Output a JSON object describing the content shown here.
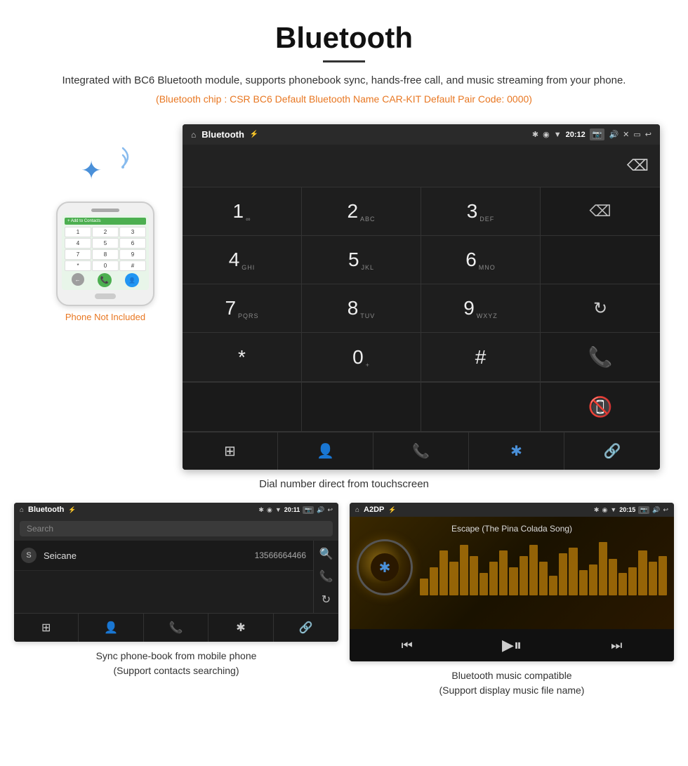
{
  "page": {
    "title": "Bluetooth",
    "divider": true,
    "description": "Integrated with BC6 Bluetooth module, supports phonebook sync, hands-free call, and music streaming from your phone.",
    "specs": "(Bluetooth chip : CSR BC6    Default Bluetooth Name CAR-KIT    Default Pair Code: 0000)",
    "caption_dial": "Dial number direct from touchscreen",
    "caption_phonebook": "Sync phone-book from mobile phone\n(Support contacts searching)",
    "caption_music": "Bluetooth music compatible\n(Support display music file name)"
  },
  "phone_label": "Phone Not Included",
  "dialpad": {
    "status_bar": {
      "home_icon": "⌂",
      "title": "Bluetooth",
      "usb_icon": "⚡",
      "bt_icon": "✱",
      "location_icon": "◉",
      "signal_icon": "▼",
      "time": "20:12",
      "camera_icon": "📷",
      "volume_icon": "🔊",
      "close_icon": "✕",
      "screen_icon": "▭",
      "back_icon": "↩"
    },
    "keys": [
      {
        "num": "1",
        "sub": "∞",
        "col": 1
      },
      {
        "num": "2",
        "sub": "ABC",
        "col": 2
      },
      {
        "num": "3",
        "sub": "DEF",
        "col": 3
      },
      {
        "num": "backspace",
        "sub": "",
        "col": 4
      },
      {
        "num": "4",
        "sub": "GHI",
        "col": 1
      },
      {
        "num": "5",
        "sub": "JKL",
        "col": 2
      },
      {
        "num": "6",
        "sub": "MNO",
        "col": 3
      },
      {
        "num": "empty",
        "col": 4
      },
      {
        "num": "7",
        "sub": "PQRS",
        "col": 1
      },
      {
        "num": "8",
        "sub": "TUV",
        "col": 2
      },
      {
        "num": "9",
        "sub": "WXYZ",
        "col": 3
      },
      {
        "num": "reload",
        "col": 4
      },
      {
        "num": "*",
        "sub": "",
        "col": 1
      },
      {
        "num": "0",
        "sub": "+",
        "col": 2
      },
      {
        "num": "#",
        "sub": "",
        "col": 3
      },
      {
        "num": "call_green",
        "col": 4
      },
      {
        "num": "call_red",
        "col": 4
      }
    ],
    "bottom_icons": [
      "grid",
      "person",
      "phone",
      "bluetooth",
      "link"
    ]
  },
  "phonebook": {
    "status_bar": {
      "home_icon": "⌂",
      "title": "Bluetooth",
      "usb_icon": "⚡",
      "bt_icon": "✱",
      "location_icon": "◉",
      "signal_icon": "▼",
      "time": "20:11",
      "camera_icon": "📷",
      "volume_icon": "🔊",
      "back_icon": "↩"
    },
    "search_placeholder": "Search",
    "contacts": [
      {
        "letter": "S",
        "name": "Seicane",
        "number": "13566664466"
      }
    ],
    "side_icons": [
      "search",
      "phone",
      "reload"
    ],
    "bottom_icons": [
      "grid",
      "person",
      "phone",
      "bluetooth",
      "link"
    ]
  },
  "music": {
    "status_bar": {
      "home_icon": "⌂",
      "title": "A2DP",
      "usb_icon": "⚡",
      "bt_icon": "✱",
      "location_icon": "◉",
      "signal_icon": "▼",
      "time": "20:15",
      "camera_icon": "📷",
      "volume_icon": "🔊",
      "back_icon": "↩"
    },
    "song_title": "Escape (The Pina Colada Song)",
    "viz_bars": [
      3,
      5,
      8,
      6,
      9,
      7,
      4,
      6,
      8,
      5,
      7,
      9,
      6,
      4,
      7,
      8,
      5,
      6,
      9,
      7,
      4,
      5,
      8,
      6,
      7
    ],
    "controls": [
      "prev",
      "play",
      "next"
    ]
  },
  "colors": {
    "accent_orange": "#e87722",
    "green_call": "#4caf50",
    "red_call": "#f44336",
    "blue_bt": "#4a90d9",
    "screen_bg": "#1a1a1a",
    "status_bg": "#2a2a2a"
  }
}
